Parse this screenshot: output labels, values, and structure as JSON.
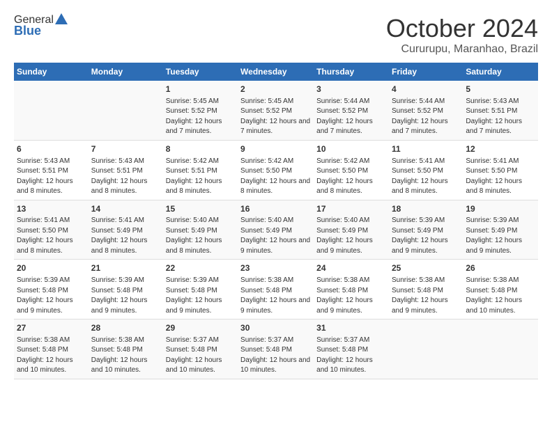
{
  "header": {
    "logo_line1": "General",
    "logo_line2": "Blue",
    "month": "October 2024",
    "location": "Cururupu, Maranhao, Brazil"
  },
  "days_of_week": [
    "Sunday",
    "Monday",
    "Tuesday",
    "Wednesday",
    "Thursday",
    "Friday",
    "Saturday"
  ],
  "weeks": [
    [
      {
        "day": "",
        "info": ""
      },
      {
        "day": "",
        "info": ""
      },
      {
        "day": "1",
        "info": "Sunrise: 5:45 AM\nSunset: 5:52 PM\nDaylight: 12 hours\nand 7 minutes."
      },
      {
        "day": "2",
        "info": "Sunrise: 5:45 AM\nSunset: 5:52 PM\nDaylight: 12 hours\nand 7 minutes."
      },
      {
        "day": "3",
        "info": "Sunrise: 5:44 AM\nSunset: 5:52 PM\nDaylight: 12 hours\nand 7 minutes."
      },
      {
        "day": "4",
        "info": "Sunrise: 5:44 AM\nSunset: 5:52 PM\nDaylight: 12 hours\nand 7 minutes."
      },
      {
        "day": "5",
        "info": "Sunrise: 5:43 AM\nSunset: 5:51 PM\nDaylight: 12 hours\nand 7 minutes."
      }
    ],
    [
      {
        "day": "6",
        "info": "Sunrise: 5:43 AM\nSunset: 5:51 PM\nDaylight: 12 hours\nand 8 minutes."
      },
      {
        "day": "7",
        "info": "Sunrise: 5:43 AM\nSunset: 5:51 PM\nDaylight: 12 hours\nand 8 minutes."
      },
      {
        "day": "8",
        "info": "Sunrise: 5:42 AM\nSunset: 5:51 PM\nDaylight: 12 hours\nand 8 minutes."
      },
      {
        "day": "9",
        "info": "Sunrise: 5:42 AM\nSunset: 5:50 PM\nDaylight: 12 hours\nand 8 minutes."
      },
      {
        "day": "10",
        "info": "Sunrise: 5:42 AM\nSunset: 5:50 PM\nDaylight: 12 hours\nand 8 minutes."
      },
      {
        "day": "11",
        "info": "Sunrise: 5:41 AM\nSunset: 5:50 PM\nDaylight: 12 hours\nand 8 minutes."
      },
      {
        "day": "12",
        "info": "Sunrise: 5:41 AM\nSunset: 5:50 PM\nDaylight: 12 hours\nand 8 minutes."
      }
    ],
    [
      {
        "day": "13",
        "info": "Sunrise: 5:41 AM\nSunset: 5:50 PM\nDaylight: 12 hours\nand 8 minutes."
      },
      {
        "day": "14",
        "info": "Sunrise: 5:41 AM\nSunset: 5:49 PM\nDaylight: 12 hours\nand 8 minutes."
      },
      {
        "day": "15",
        "info": "Sunrise: 5:40 AM\nSunset: 5:49 PM\nDaylight: 12 hours\nand 8 minutes."
      },
      {
        "day": "16",
        "info": "Sunrise: 5:40 AM\nSunset: 5:49 PM\nDaylight: 12 hours\nand 9 minutes."
      },
      {
        "day": "17",
        "info": "Sunrise: 5:40 AM\nSunset: 5:49 PM\nDaylight: 12 hours\nand 9 minutes."
      },
      {
        "day": "18",
        "info": "Sunrise: 5:39 AM\nSunset: 5:49 PM\nDaylight: 12 hours\nand 9 minutes."
      },
      {
        "day": "19",
        "info": "Sunrise: 5:39 AM\nSunset: 5:49 PM\nDaylight: 12 hours\nand 9 minutes."
      }
    ],
    [
      {
        "day": "20",
        "info": "Sunrise: 5:39 AM\nSunset: 5:48 PM\nDaylight: 12 hours\nand 9 minutes."
      },
      {
        "day": "21",
        "info": "Sunrise: 5:39 AM\nSunset: 5:48 PM\nDaylight: 12 hours\nand 9 minutes."
      },
      {
        "day": "22",
        "info": "Sunrise: 5:39 AM\nSunset: 5:48 PM\nDaylight: 12 hours\nand 9 minutes."
      },
      {
        "day": "23",
        "info": "Sunrise: 5:38 AM\nSunset: 5:48 PM\nDaylight: 12 hours\nand 9 minutes."
      },
      {
        "day": "24",
        "info": "Sunrise: 5:38 AM\nSunset: 5:48 PM\nDaylight: 12 hours\nand 9 minutes."
      },
      {
        "day": "25",
        "info": "Sunrise: 5:38 AM\nSunset: 5:48 PM\nDaylight: 12 hours\nand 9 minutes."
      },
      {
        "day": "26",
        "info": "Sunrise: 5:38 AM\nSunset: 5:48 PM\nDaylight: 12 hours\nand 10 minutes."
      }
    ],
    [
      {
        "day": "27",
        "info": "Sunrise: 5:38 AM\nSunset: 5:48 PM\nDaylight: 12 hours\nand 10 minutes."
      },
      {
        "day": "28",
        "info": "Sunrise: 5:38 AM\nSunset: 5:48 PM\nDaylight: 12 hours\nand 10 minutes."
      },
      {
        "day": "29",
        "info": "Sunrise: 5:37 AM\nSunset: 5:48 PM\nDaylight: 12 hours\nand 10 minutes."
      },
      {
        "day": "30",
        "info": "Sunrise: 5:37 AM\nSunset: 5:48 PM\nDaylight: 12 hours\nand 10 minutes."
      },
      {
        "day": "31",
        "info": "Sunrise: 5:37 AM\nSunset: 5:48 PM\nDaylight: 12 hours\nand 10 minutes."
      },
      {
        "day": "",
        "info": ""
      },
      {
        "day": "",
        "info": ""
      }
    ]
  ]
}
